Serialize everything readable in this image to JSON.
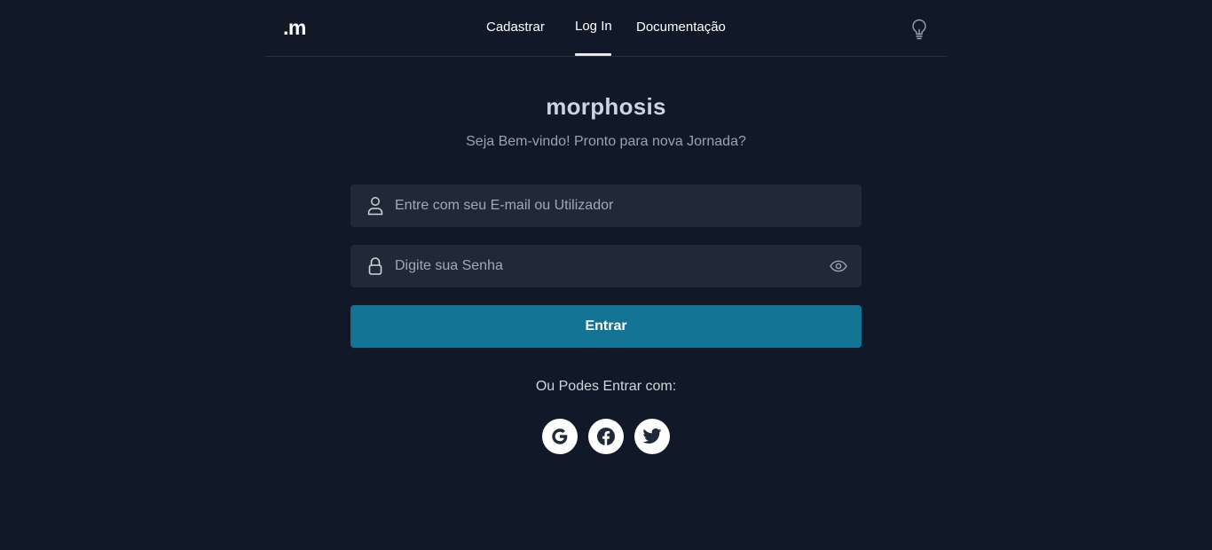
{
  "brand": {
    "logo": ".m"
  },
  "nav": {
    "links": [
      {
        "label": "Cadastrar"
      },
      {
        "label": "Log In",
        "active": true
      },
      {
        "label": "Documentação"
      }
    ],
    "theme_toggle_icon": "lightbulb-icon"
  },
  "hero": {
    "title": "morphosis",
    "subtitle": "Seja Bem-vindo! Pronto para nova Jornada?"
  },
  "form": {
    "user_field": {
      "placeholder": "Entre com seu E-mail ou Utilizador",
      "value": "",
      "icon": "user-icon"
    },
    "password_field": {
      "placeholder": "Digite sua Senha",
      "value": "",
      "icon": "lock-icon",
      "toggle_icon": "eye-icon"
    },
    "submit_label": "Entrar"
  },
  "social": {
    "label": "Ou Podes Entrar com:",
    "providers": [
      {
        "name": "google",
        "icon": "google-icon"
      },
      {
        "name": "facebook",
        "icon": "facebook-icon"
      },
      {
        "name": "twitter",
        "icon": "twitter-icon"
      }
    ]
  },
  "colors": {
    "background": "#111827",
    "input_background": "#1f2937",
    "primary_button": "#137394",
    "text_primary": "#ffffff",
    "text_muted": "#9ca3af"
  }
}
